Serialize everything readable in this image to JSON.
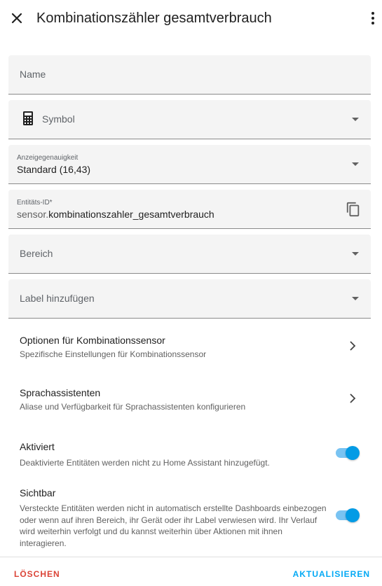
{
  "dialog": {
    "title": "Kombinationszähler gesamtverbrauch"
  },
  "icons": {
    "close": "close-icon",
    "more": "dots-vertical-icon",
    "symbol": "calculator-icon",
    "copy": "content-copy-icon",
    "chevron": "chevron-right-icon",
    "dropdown": "menu-down-icon"
  },
  "fields": {
    "name": {
      "placeholder": "Name"
    },
    "symbol": {
      "placeholder": "Symbol"
    },
    "precision": {
      "label": "Anzeigegenauigkeit",
      "value": "Standard (16,43)"
    },
    "entity_id": {
      "label": "Entitäts-ID*",
      "prefix": "sensor.",
      "value": "kombinationszahler_gesamtverbrauch"
    },
    "area": {
      "placeholder": "Bereich"
    },
    "labels": {
      "placeholder": "Label hinzufügen"
    }
  },
  "sections": {
    "combination": {
      "title": "Optionen für Kombinationssensor",
      "subtitle": "Spezifische Einstellungen für Kombinationssensor"
    },
    "voice": {
      "title": "Sprachassistenten",
      "subtitle": "Aliase und Verfügbarkeit für Sprachassistenten konfigurieren"
    },
    "enabled": {
      "title": "Aktiviert",
      "subtitle": "Deaktivierte Entitäten werden nicht zu Home Assistant hinzugefügt.",
      "checked": true
    },
    "visible": {
      "title": "Sichtbar",
      "subtitle": "Versteckte Entitäten werden nicht in automatisch erstellte Dashboards einbezogen oder wenn auf ihren Bereich, ihr Gerät oder ihr Label verwiesen wird. Ihr Verlauf wird weiterhin verfolgt und du kannst weiterhin über Aktionen mit ihnen interagieren.",
      "checked": true
    }
  },
  "actions": {
    "delete_label": "LÖSCHEN",
    "update_label": "AKTUALISIEREN"
  },
  "colors": {
    "accent": "#03a9f4",
    "toggle_on": "#039be5",
    "danger": "#db4437",
    "field_bg": "#f4f4f4"
  }
}
